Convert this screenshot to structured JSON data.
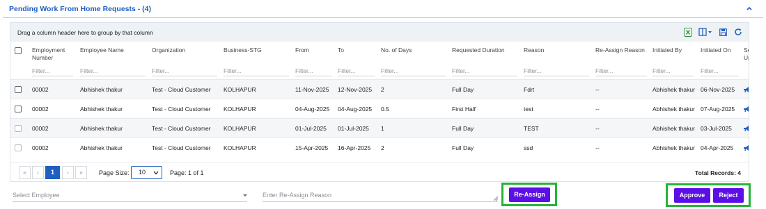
{
  "panel": {
    "title": "Pending Work From Home Requests - (4)"
  },
  "grid": {
    "group_hint": "Drag a column header here to group by that column",
    "columns": [
      {
        "label": "Employment Number",
        "filter": "Filter..."
      },
      {
        "label": "Employee Name",
        "filter": "Filter..."
      },
      {
        "label": "Organization",
        "filter": "Filter..."
      },
      {
        "label": "Business-STG",
        "filter": "Filter..."
      },
      {
        "label": "From",
        "filter": "Filter..."
      },
      {
        "label": "To",
        "filter": "Filter..."
      },
      {
        "label": "No. of Days",
        "filter": "Filter..."
      },
      {
        "label": "Requested Duration",
        "filter": "Filter..."
      },
      {
        "label": "Reason",
        "filter": "Filter..."
      },
      {
        "label": "Re-Assign Reason",
        "filter": "Filter..."
      },
      {
        "label": "Initiated By",
        "filter": "Filter..."
      },
      {
        "label": "Initiated On",
        "filter": "Filter..."
      },
      {
        "label": "Se Up",
        "filter": ""
      }
    ],
    "rows": [
      [
        "00002",
        "Abhishek thakur",
        "Test - Cloud Customer",
        "KOLHAPUR",
        "11-Nov-2025",
        "12-Nov-2025",
        "2",
        "Full Day",
        "Fdrt",
        "--",
        "Abhishek thakur",
        "06-Nov-2025"
      ],
      [
        "00002",
        "Abhishek thakur",
        "Test - Cloud Customer",
        "KOLHAPUR",
        "04-Aug-2025",
        "04-Aug-2025",
        "0.5",
        "First Half",
        "test",
        "--",
        "Abhishek thakur",
        "07-Aug-2025"
      ],
      [
        "00002",
        "Abhishek thakur",
        "Test - Cloud Customer",
        "KOLHAPUR",
        "01-Jul-2025",
        "01-Jul-2025",
        "1",
        "Full Day",
        "TEST",
        "--",
        "Abhishek thakur",
        "03-Jul-2025"
      ],
      [
        "00002",
        "Abhishek thakur",
        "Test - Cloud Customer",
        "KOLHAPUR",
        "15-Apr-2025",
        "16-Apr-2025",
        "2",
        "Full Day",
        "ssd",
        "--",
        "Abhishek thakur",
        "04-Apr-2025"
      ]
    ]
  },
  "pager": {
    "first": "«",
    "prev": "‹",
    "current": "1",
    "next": "›",
    "last": "»",
    "page_size_label": "Page Size:",
    "page_size": "10",
    "page_info": "Page: 1 of 1",
    "total": "Total Records: 4"
  },
  "form": {
    "employee_placeholder": "Select Employee",
    "reason_placeholder": "Enter Re-Assign Reason"
  },
  "buttons": {
    "reassign": "Re-Assign",
    "approve": "Approve",
    "reject": "Reject"
  },
  "colors": {
    "title": "#1f5fc2",
    "button": "#5b0fe6",
    "highlight": "#27b13a",
    "excel_icon": "#2e8b3e"
  },
  "icons": [
    "chevron-up-icon",
    "excel-export-icon",
    "columns-icon",
    "save-icon",
    "refresh-icon",
    "megaphone-icon"
  ]
}
